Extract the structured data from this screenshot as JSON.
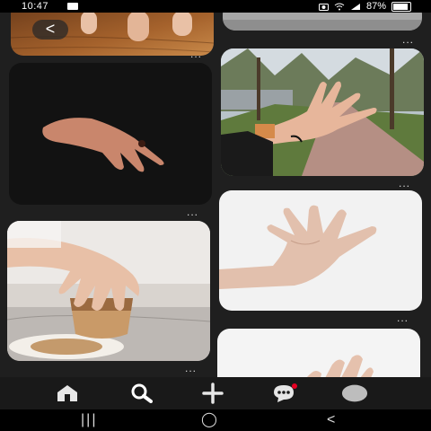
{
  "status_bar": {
    "time": "10:47",
    "battery": "87%",
    "battery_level": 0.87
  },
  "back_button": {
    "label": "<"
  },
  "cards": [
    {
      "menu": "..."
    },
    {
      "menu": "..."
    },
    {
      "menu": "..."
    },
    {
      "menu": "..."
    },
    {
      "menu": "..."
    },
    {
      "menu": "..."
    }
  ],
  "bottom_nav": {
    "items": [
      "home-icon",
      "search-icon",
      "add-icon",
      "messages-icon",
      "profile-icon"
    ]
  },
  "system_nav": {
    "recents": "|||",
    "home": "◯",
    "back": "<"
  }
}
